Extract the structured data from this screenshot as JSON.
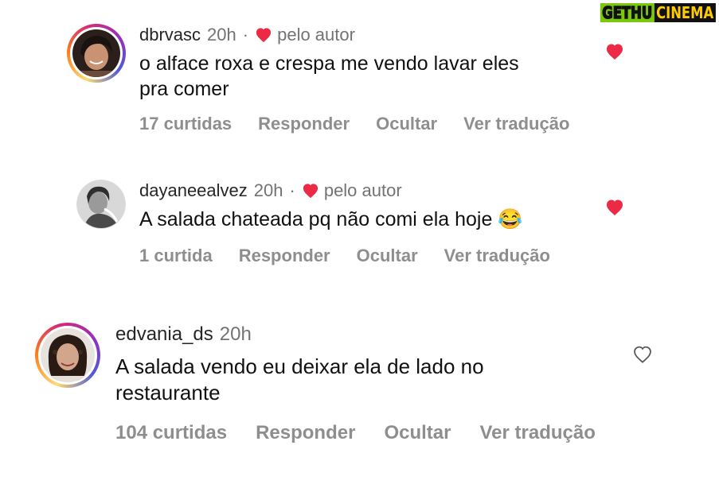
{
  "watermark": {
    "part1": "GETHU",
    "part2": "CINEMA"
  },
  "comments": [
    {
      "username": "dbrvasc",
      "time": "20h",
      "separator": "·",
      "author_badge": "pelo autor",
      "text_line1": "o alface roxa e crespa me vendo lavar eles",
      "text_line2": "pra comer",
      "likes": "17 curtidas",
      "reply": "Responder",
      "hide": "Ocultar",
      "translate": "Ver tradução",
      "liked": true
    },
    {
      "username": "dayaneealvez",
      "time": "20h",
      "separator": "·",
      "author_badge": "pelo autor",
      "text_line1": "A salada chateada pq não comi ela hoje 😂",
      "likes": "1 curtida",
      "reply": "Responder",
      "hide": "Ocultar",
      "translate": "Ver tradução",
      "liked": true
    },
    {
      "username": "edvania_ds",
      "time": "20h",
      "text_line1": "A salada vendo eu deixar ela de lado no",
      "text_line2": "restaurante",
      "likes": "104 curtidas",
      "reply": "Responder",
      "hide": "Ocultar",
      "translate": "Ver tradução",
      "liked": false
    }
  ],
  "colors": {
    "heart_red": "#ed2a45",
    "secondary_text": "#8e8e8e",
    "primary_text": "#111111"
  }
}
